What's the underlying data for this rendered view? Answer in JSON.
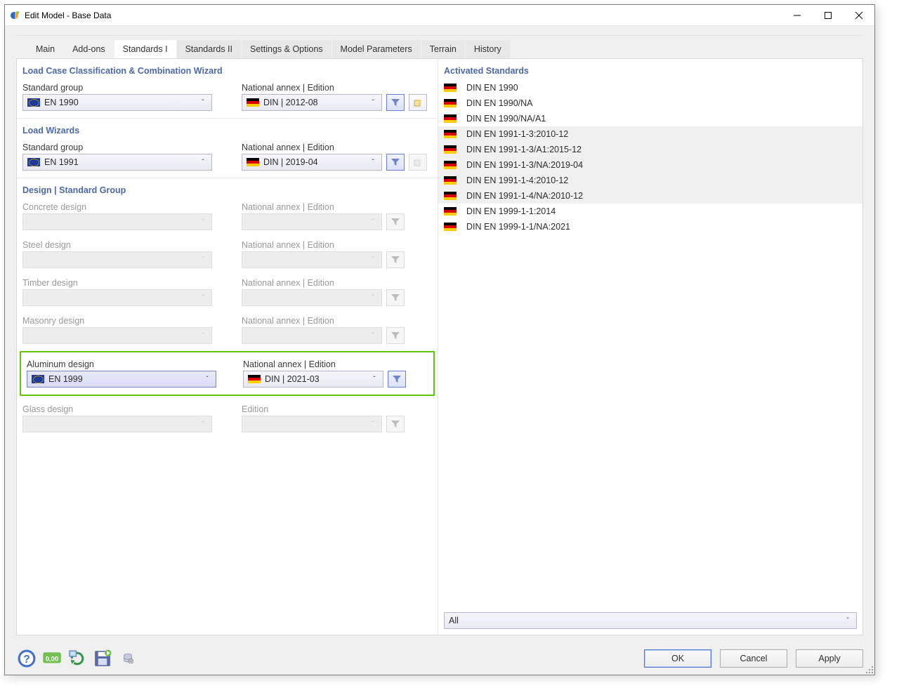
{
  "window": {
    "title": "Edit Model - Base Data"
  },
  "tabs": [
    "Main",
    "Add-ons",
    "Standards I",
    "Standards II",
    "Settings & Options",
    "Model Parameters",
    "Terrain",
    "History"
  ],
  "active_tab_index": 2,
  "sections": {
    "lccw": {
      "title": "Load Case Classification & Combination Wizard",
      "std_label": "Standard group",
      "std_value": "EN 1990",
      "annex_label": "National annex | Edition",
      "annex_value": "DIN | 2012-08"
    },
    "loadwiz": {
      "title": "Load Wizards",
      "std_label": "Standard group",
      "std_value": "EN 1991",
      "annex_label": "National annex | Edition",
      "annex_value": "DIN | 2019-04"
    },
    "design": {
      "title": "Design | Standard Group",
      "rows": [
        {
          "label": "Concrete design",
          "std": "",
          "annex_label": "National annex | Edition",
          "annex": "",
          "disabled": true
        },
        {
          "label": "Steel design",
          "std": "",
          "annex_label": "National annex | Edition",
          "annex": "",
          "disabled": true
        },
        {
          "label": "Timber design",
          "std": "",
          "annex_label": "National annex | Edition",
          "annex": "",
          "disabled": true
        },
        {
          "label": "Masonry design",
          "std": "",
          "annex_label": "National annex | Edition",
          "annex": "",
          "disabled": true
        }
      ],
      "aluminum": {
        "label": "Aluminum design",
        "std": "EN 1999",
        "annex_label": "National annex | Edition",
        "annex": "DIN | 2021-03"
      },
      "glass": {
        "label": "Glass design",
        "std": "",
        "annex_label": "Edition",
        "annex": "",
        "disabled": true
      }
    }
  },
  "right": {
    "title": "Activated Standards",
    "items": [
      {
        "text": "DIN EN 1990",
        "shade": false
      },
      {
        "text": "DIN EN 1990/NA",
        "shade": false
      },
      {
        "text": "DIN EN 1990/NA/A1",
        "shade": false
      },
      {
        "text": "DIN EN 1991-1-3:2010-12",
        "shade": true
      },
      {
        "text": "DIN EN 1991-1-3/A1:2015-12",
        "shade": true
      },
      {
        "text": "DIN EN 1991-1-3/NA:2019-04",
        "shade": true
      },
      {
        "text": "DIN EN 1991-1-4:2010-12",
        "shade": true
      },
      {
        "text": "DIN EN 1991-1-4/NA:2010-12",
        "shade": true
      },
      {
        "text": "DIN EN 1999-1-1:2014",
        "shade": false
      },
      {
        "text": "DIN EN 1999-1-1/NA:2021",
        "shade": false
      }
    ],
    "filter_value": "All"
  },
  "buttons": {
    "ok": "OK",
    "cancel": "Cancel",
    "apply": "Apply"
  }
}
